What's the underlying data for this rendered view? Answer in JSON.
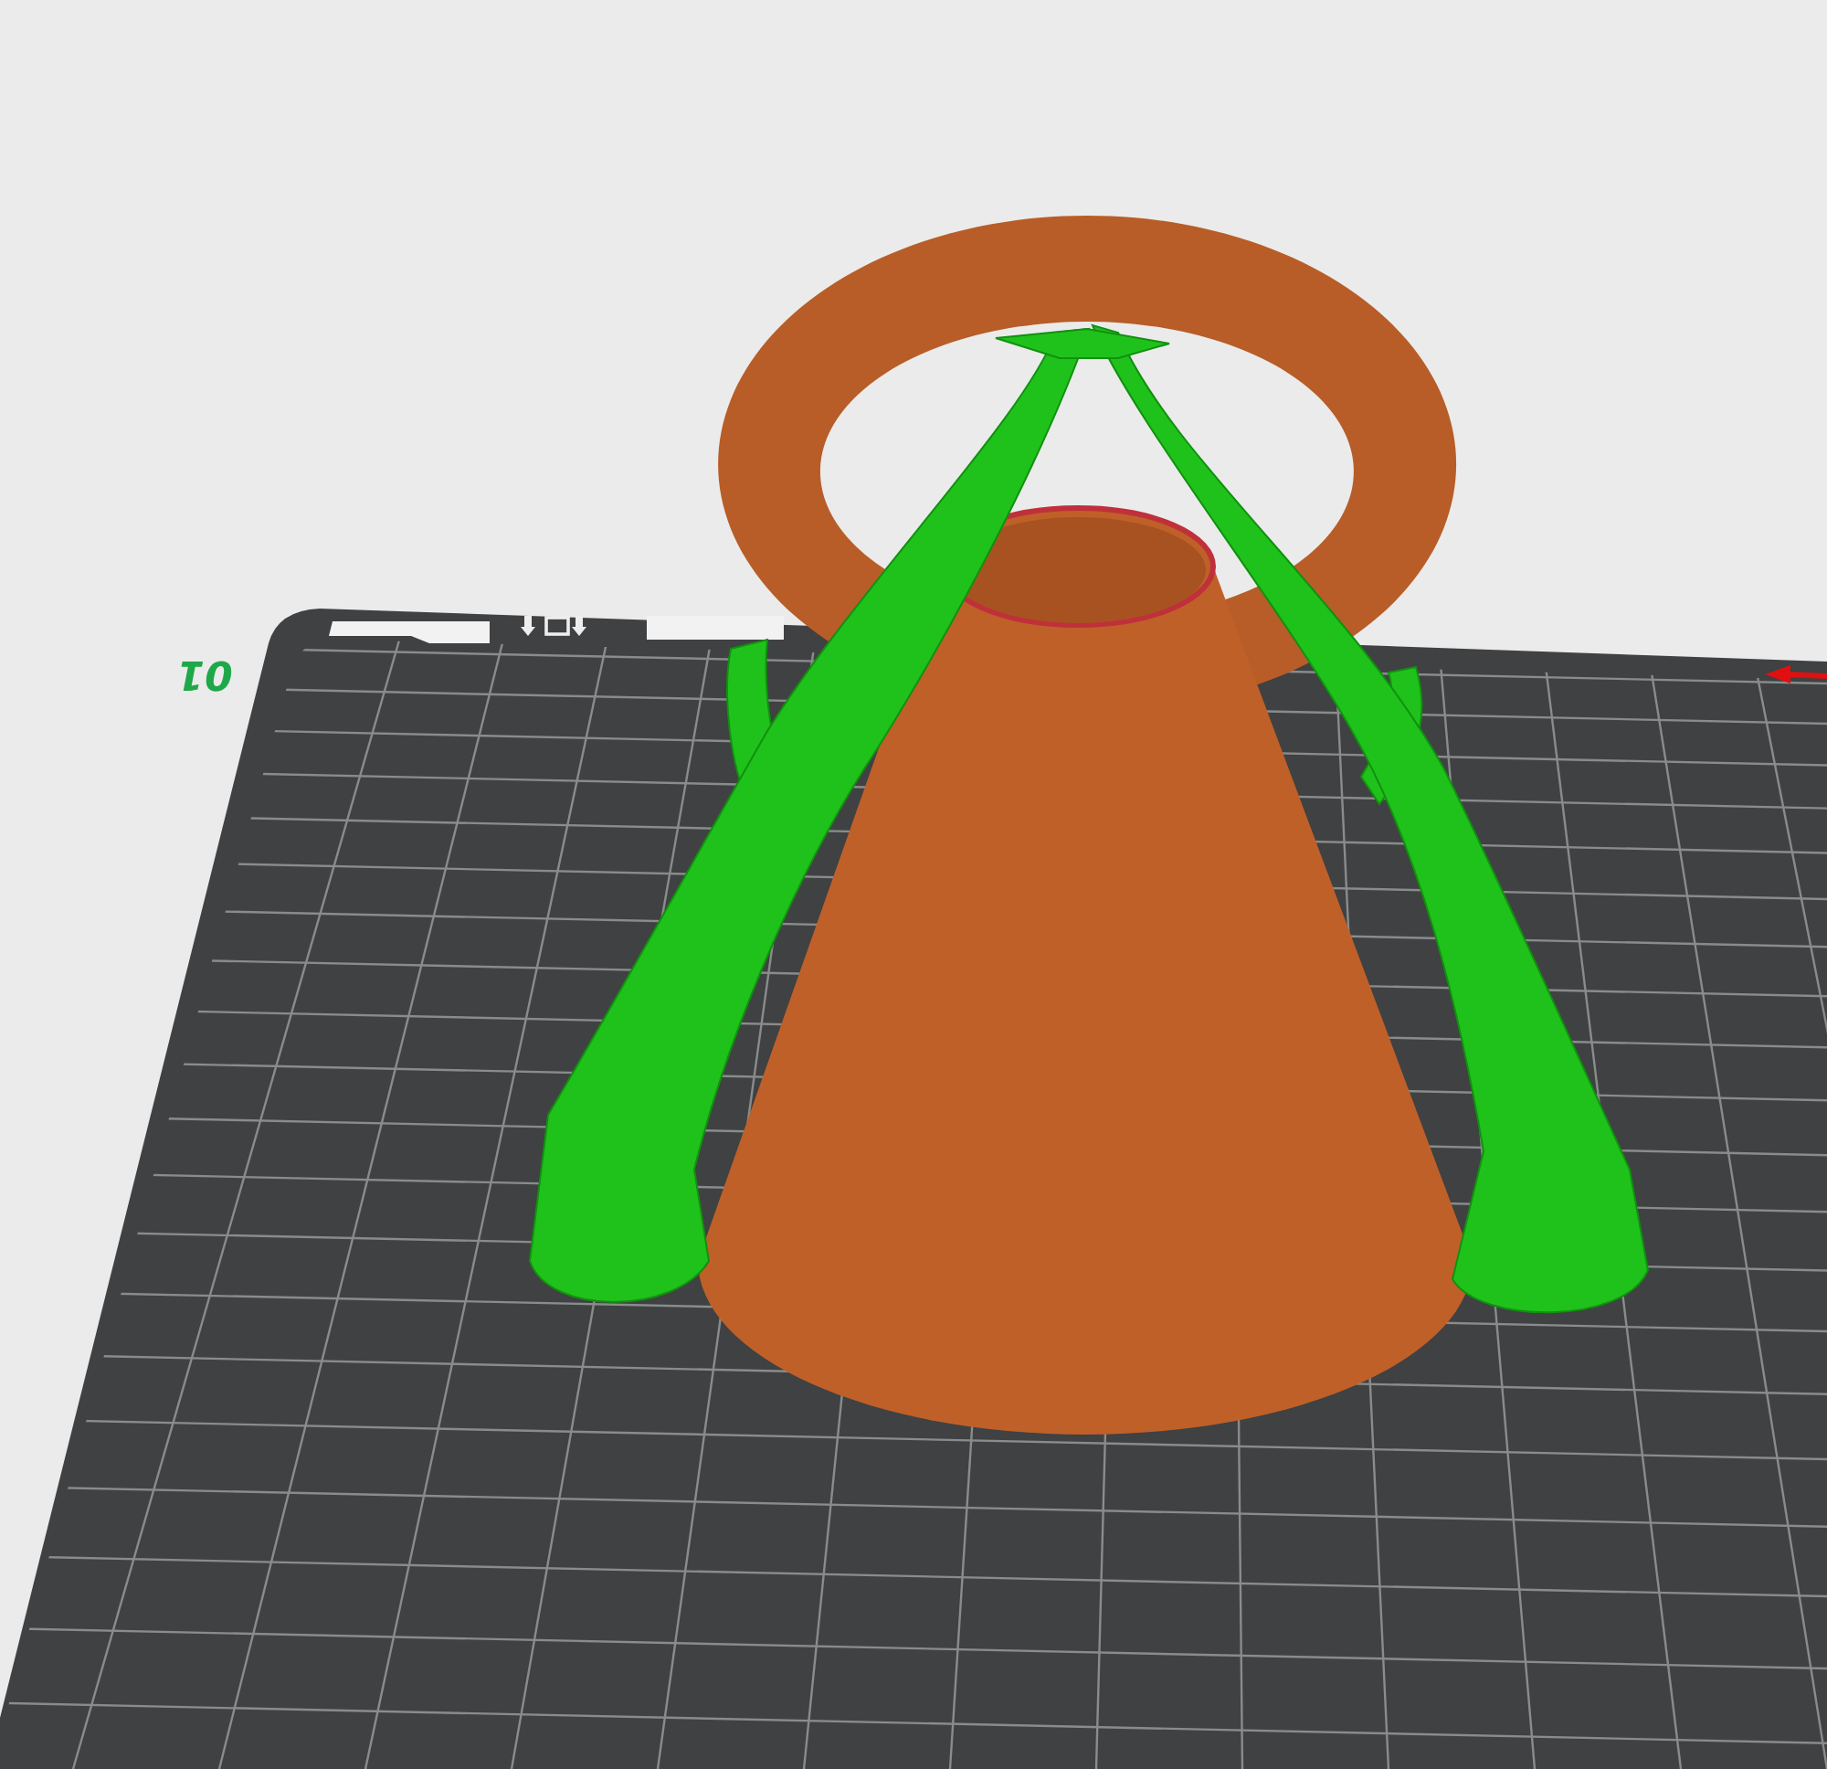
{
  "viewport": {
    "plate_label": "01"
  }
}
